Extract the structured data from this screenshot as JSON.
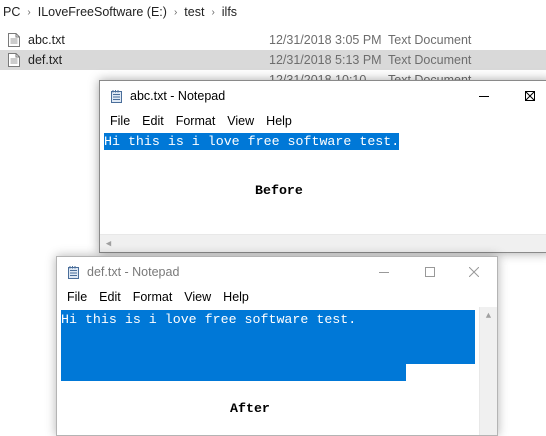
{
  "explorer": {
    "breadcrumb": [
      {
        "label": "PC"
      },
      {
        "label": "ILoveFreeSoftware (E:)"
      },
      {
        "label": "test"
      },
      {
        "label": "ilfs"
      }
    ],
    "files": [
      {
        "name": "abc.txt",
        "date": "12/31/2018 3:05 PM",
        "type": "Text Document",
        "selected": false
      },
      {
        "name": "def.txt",
        "date": "12/31/2018 5:13 PM",
        "type": "Text Document",
        "selected": true
      },
      {
        "name": "",
        "date": "12/31/2018 10:10",
        "type": "Text Document",
        "selected": false
      }
    ]
  },
  "window_abc": {
    "title": "abc.txt - Notepad",
    "menu": [
      "File",
      "Edit",
      "Format",
      "View",
      "Help"
    ],
    "content_line": "Hi this is i love free software test.",
    "annotation": "Before",
    "active": true
  },
  "window_def": {
    "title": "def.txt - Notepad",
    "menu": [
      "File",
      "Edit",
      "Format",
      "View",
      "Help"
    ],
    "content_line": "Hi this is i love free software test.",
    "annotation": "After",
    "active": false
  },
  "colors": {
    "selection": "#0078d7",
    "selected_row": "#d9d9d9",
    "secondary_text": "#6d6d6d"
  }
}
